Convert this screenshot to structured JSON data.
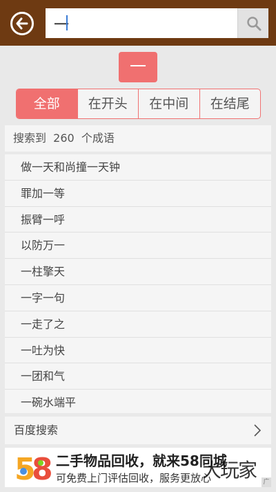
{
  "header": {
    "back_icon": "back-arrow-circle-icon",
    "search_value": "一",
    "search_icon": "search-icon"
  },
  "query_char": "一",
  "filter_tabs": [
    {
      "label": "全部",
      "active": true
    },
    {
      "label": "在开头",
      "active": false
    },
    {
      "label": "在中间",
      "active": false
    },
    {
      "label": "在结尾",
      "active": false
    }
  ],
  "result_summary": "搜索到  260  个成语",
  "idioms": [
    "做一天和尚撞一天钟",
    "罪加一等",
    "振臂一呼",
    "以防万一",
    "一柱擎天",
    "一字一句",
    "一走了之",
    "一吐为快",
    "一团和气",
    "一碗水端平"
  ],
  "baidu_search": {
    "label": "百度搜索",
    "icon": "chevron-right-icon"
  },
  "ad": {
    "logo_text": "58",
    "title": "二手物品回收，就来58同城",
    "description": "可免费上门评估回收，服务更放心",
    "watermark": "大玩家",
    "corner_label": "广"
  },
  "colors": {
    "header_bg": "#6e3a12",
    "accent": "#f07070",
    "page_bg": "#e9e9e9"
  }
}
